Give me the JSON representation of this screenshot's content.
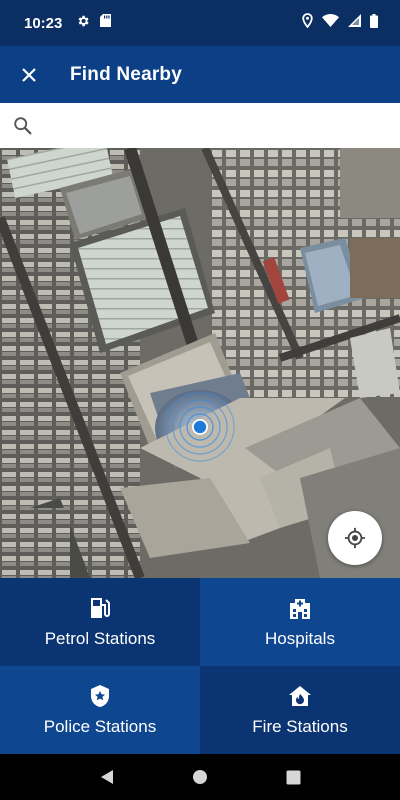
{
  "status_bar": {
    "time": "10:23",
    "left_icons": [
      "gear-icon",
      "sd-card-icon"
    ],
    "right_icons": [
      "location-pin-icon",
      "wifi-icon",
      "signal-icon",
      "battery-icon"
    ]
  },
  "app_bar": {
    "title": "Find Nearby",
    "close_icon": "close-icon"
  },
  "search": {
    "placeholder": "",
    "value": "",
    "icon": "search-icon"
  },
  "map": {
    "locate_icon": "my-location-icon",
    "user_marker": "current-location-marker"
  },
  "categories": [
    {
      "label": "Petrol Stations",
      "icon": "fuel-pump-icon"
    },
    {
      "label": "Hospitals",
      "icon": "hospital-icon"
    },
    {
      "label": "Police Stations",
      "icon": "police-badge-icon"
    },
    {
      "label": "Fire Stations",
      "icon": "fire-station-icon"
    }
  ],
  "nav_bar": {
    "back_icon": "back-triangle-icon",
    "home_icon": "home-circle-icon",
    "recents_icon": "recents-square-icon"
  },
  "colors": {
    "status_bar": "#0c2f63",
    "app_bar": "#0c3f85",
    "tile_dark": "#0b3472",
    "tile_light": "#0f4690",
    "location_dot": "#1e7bd8"
  }
}
